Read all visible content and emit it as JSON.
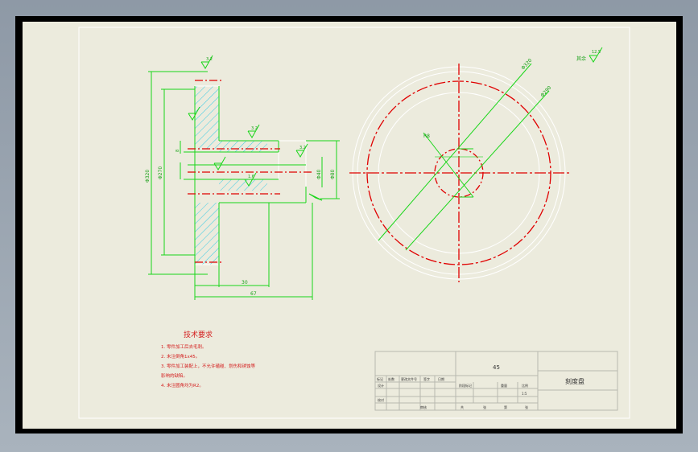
{
  "tech_req": {
    "title": "技术要求",
    "items": [
      "1. 零件加工后去毛刺。",
      "2. 未注倒角1x45。",
      "3. 零件加工装配上，不允许磕碰、划伤和锈蚀等",
      "   影响的缺陷。",
      "4. 未注圆角均为R2。"
    ]
  },
  "title_block": {
    "drawing_name": "刻度盘",
    "scale": "1:5",
    "material": "45",
    "cells_left": [
      "标记",
      "处数",
      "更改文件号",
      "签字",
      "日期"
    ],
    "cells_left2": [
      "设计",
      "校对",
      "审核"
    ],
    "cells_mid": [
      "阶段标记",
      "重量",
      "比例"
    ],
    "cells_bottom": [
      "共",
      "张",
      "第",
      "张"
    ]
  },
  "dims": {
    "d_outer": "Φ320",
    "d_mid": "Φ270",
    "d_hub": "Φ80",
    "d_bore": "Φ40",
    "len_total": "67",
    "len_hub": "30",
    "thk": "8",
    "rough_top": "12.5",
    "rough_note": "其余",
    "rough_mid": "3.2",
    "rough_bore": "1.6",
    "angle1": "Φ320",
    "angle2": "Φ290",
    "angle3": "R8"
  }
}
